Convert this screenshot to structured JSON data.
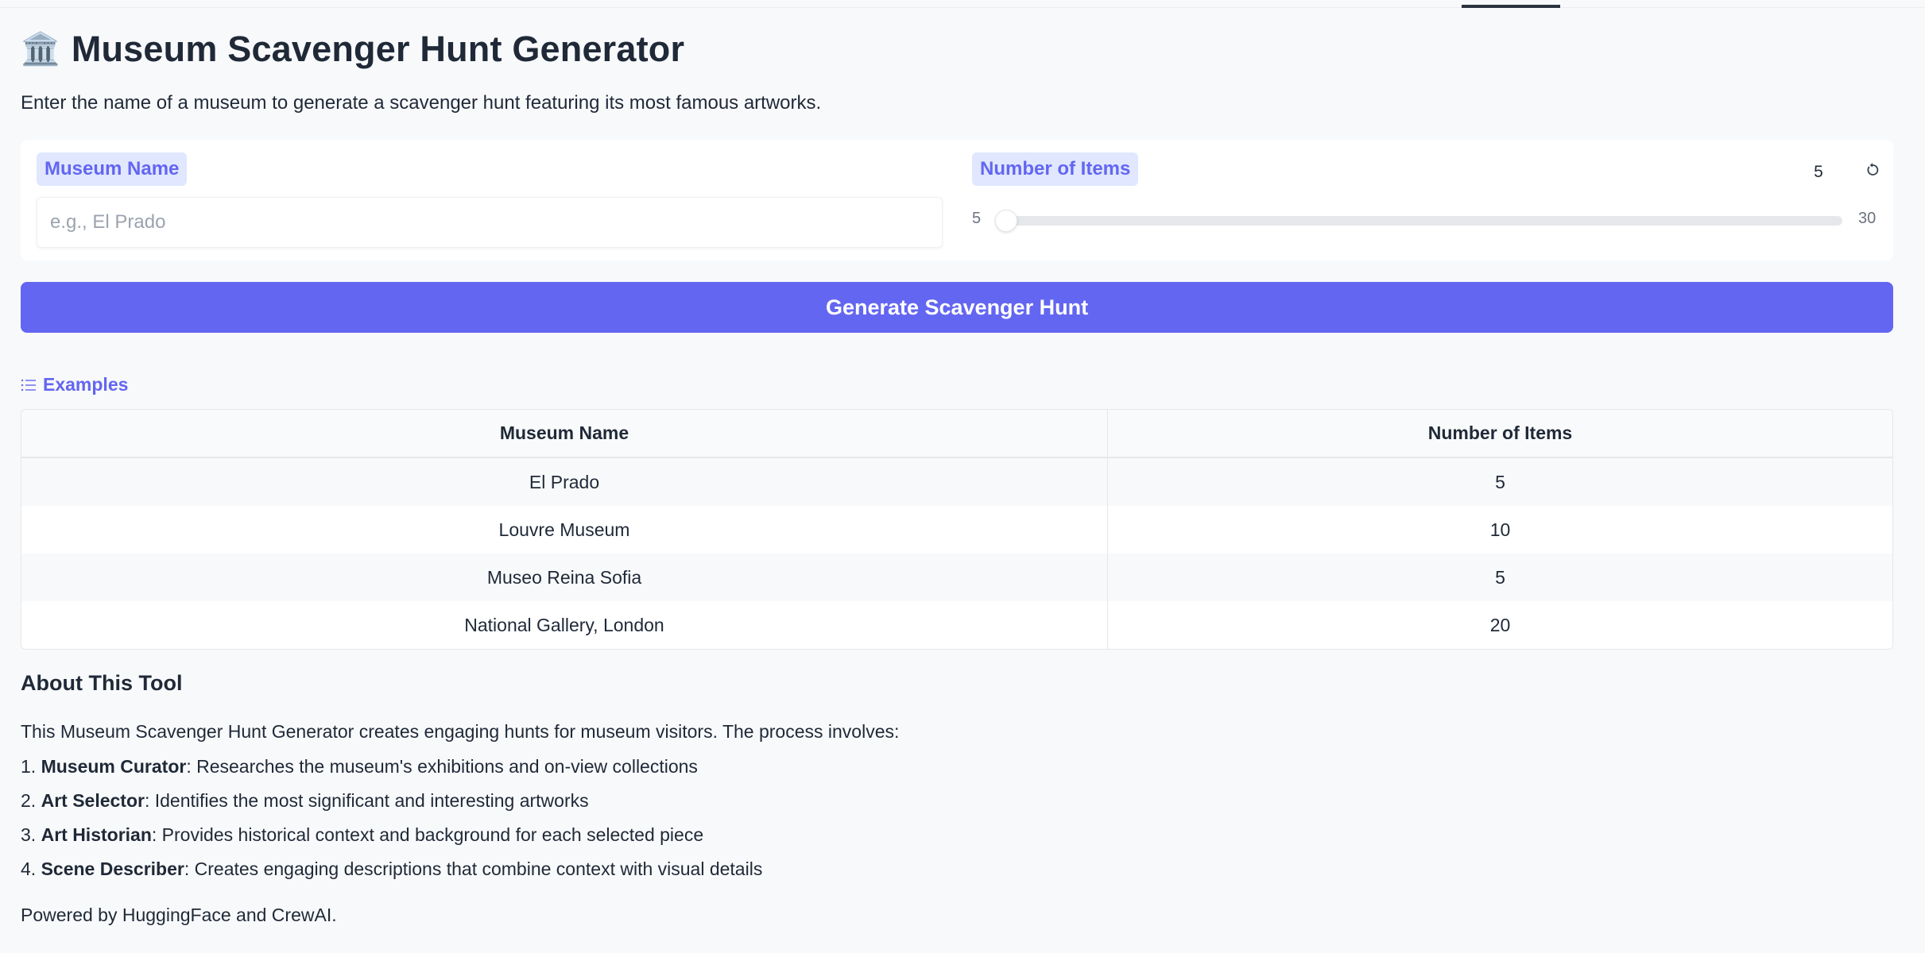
{
  "app": {
    "emoji": "🏛️",
    "title": "Museum Scavenger Hunt Generator",
    "subtitle": "Enter the name of a museum to generate a scavenger hunt featuring its most famous artworks."
  },
  "inputs": {
    "museum_label": "Museum Name",
    "museum_placeholder": "e.g., El Prado",
    "museum_value": "",
    "items_label": "Number of Items",
    "items_value": "5",
    "slider_min": "5",
    "slider_max": "30",
    "slider_fraction": 0.0
  },
  "generate_button": "Generate Scavenger Hunt",
  "examples": {
    "header": "Examples",
    "columns": [
      "Museum Name",
      "Number of Items"
    ],
    "rows": [
      [
        "El Prado",
        "5"
      ],
      [
        "Louvre Museum",
        "10"
      ],
      [
        "Museo Reina Sofia",
        "5"
      ],
      [
        "National Gallery, London",
        "20"
      ]
    ]
  },
  "about": {
    "title": "About This Tool",
    "intro": "This Museum Scavenger Hunt Generator creates engaging hunts for museum visitors. The process involves:",
    "steps": [
      {
        "num": "1.",
        "role": "Museum Curator",
        "desc": ": Researches the museum's exhibitions and on-view collections"
      },
      {
        "num": "2.",
        "role": "Art Selector",
        "desc": ": Identifies the most significant and interesting artworks"
      },
      {
        "num": "3.",
        "role": "Art Historian",
        "desc": ": Provides historical context and background for each selected piece"
      },
      {
        "num": "4.",
        "role": "Scene Describer",
        "desc": ": Creates engaging descriptions that combine context with visual details"
      }
    ],
    "powered_by": "Powered by HuggingFace and CrewAI."
  },
  "colors": {
    "accent": "#6366f1",
    "label_bg": "#e0e7ff",
    "page_bg": "#f8f9fb"
  },
  "icons": {
    "reset": "reset-icon",
    "examples": "list-icon"
  }
}
